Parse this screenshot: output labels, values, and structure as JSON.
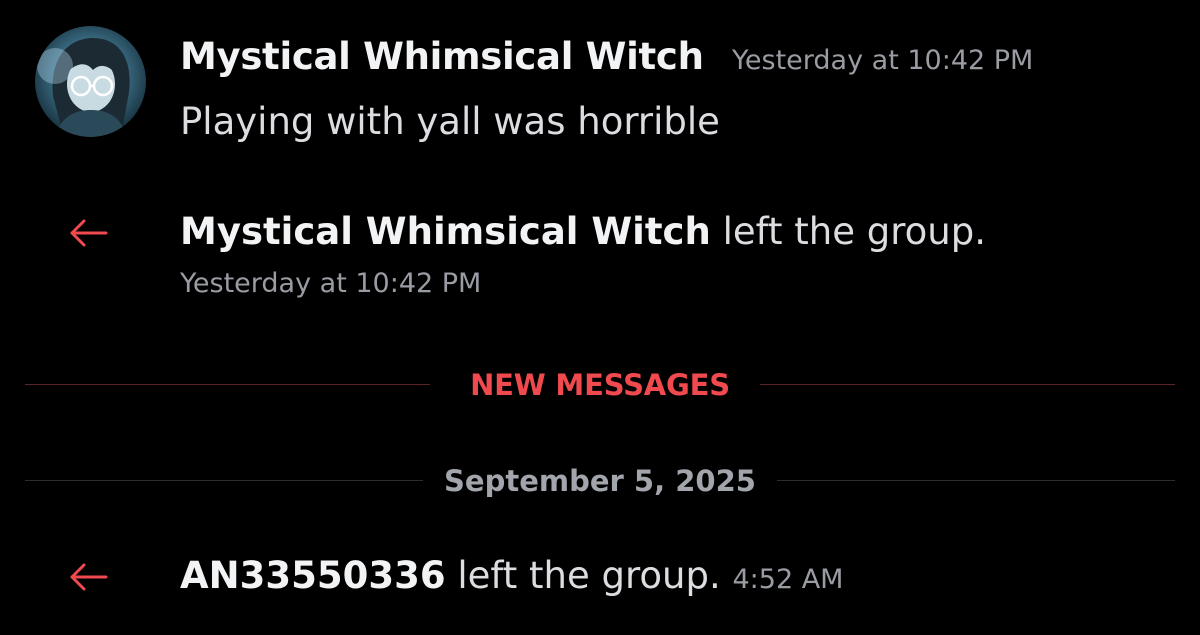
{
  "colors": {
    "background": "#000000",
    "accent_red": "#f04a4f",
    "text_primary": "#f2f3f5",
    "text_muted": "#9a9ca3"
  },
  "message": {
    "avatar_icon": "user-avatar",
    "author": "Mystical Whimsical Witch",
    "timestamp": "Yesterday at 10:42 PM",
    "text": "Playing with yall was horrible"
  },
  "system_events": [
    {
      "icon": "arrow-left-icon",
      "user": "Mystical Whimsical Witch",
      "action": "left the group.",
      "timestamp": "Yesterday at 10:42 PM"
    },
    {
      "icon": "arrow-left-icon",
      "user": "AN33550336",
      "action": "left the group.",
      "timestamp": "4:52 AM"
    }
  ],
  "dividers": {
    "new_messages": "NEW MESSAGES",
    "date": "September 5, 2025"
  }
}
